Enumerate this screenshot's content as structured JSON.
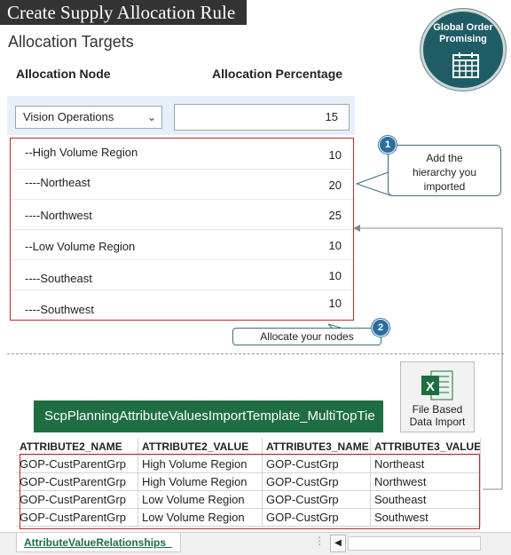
{
  "header": {
    "title": "Create Supply Allocation Rule",
    "subtitle": "Allocation Targets",
    "badge": "Global Order Promising",
    "badge_icon": "calendar-icon"
  },
  "table": {
    "col_node": "Allocation Node",
    "col_percentage": "Allocation Percentage",
    "selected_node": "Vision Operations",
    "selected_percentage": "15",
    "rows": [
      {
        "label": "--High  Volume Region",
        "value": "10"
      },
      {
        "label": "----Northeast",
        "value": "20"
      },
      {
        "label": "----Northwest",
        "value": "25"
      },
      {
        "label": "--Low  Volume Region",
        "value": "10"
      },
      {
        "label": "----Southeast",
        "value": "10"
      },
      {
        "label": "----Southwest",
        "value": "10"
      }
    ]
  },
  "callouts": {
    "c1_num": "1",
    "c1_text": "Add the hierarchy you imported",
    "c2_num": "2",
    "c2_text": "Allocate your nodes"
  },
  "spreadsheet": {
    "title": "ScpPlanningAttributeValuesImportTemplate_MultiTopTie",
    "file_button": "File Based Data Import",
    "headers": [
      "ATTRIBUTE2_NAME",
      "ATTRIBUTE2_VALUE",
      "ATTRIBUTE3_NAME",
      "ATTRIBUTE3_VALUE"
    ],
    "rows": [
      [
        "GOP-CustParentGrp",
        "High Volume Region",
        "GOP-CustGrp",
        "Northeast"
      ],
      [
        "GOP-CustParentGrp",
        "High Volume Region",
        "GOP-CustGrp",
        "Northwest"
      ],
      [
        "GOP-CustParentGrp",
        "Low Volume Region",
        "GOP-CustGrp",
        "Southeast"
      ],
      [
        "GOP-CustParentGrp",
        "Low Volume Region",
        "GOP-CustGrp",
        "Southwest"
      ]
    ],
    "tab": "AttributeValueRelationships_",
    "colors": {
      "excel_green": "#1e6e42",
      "highlight_red": "#c0272d",
      "badge_teal": "#1f5c66"
    }
  }
}
